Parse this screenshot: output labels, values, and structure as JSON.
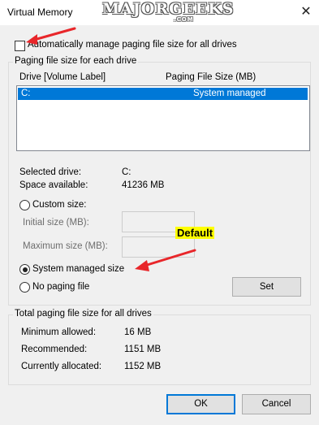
{
  "window": {
    "title": "Virtual Memory",
    "close_glyph": "✕"
  },
  "watermark": {
    "text": "MAJORGEEKS",
    "sub": ".COM"
  },
  "auto_manage": {
    "label": "Automatically manage paging file size for all drives",
    "checked": false
  },
  "paging_group": {
    "legend": "Paging file size for each drive",
    "columns": [
      "Drive  [Volume Label]",
      "Paging File Size (MB)"
    ],
    "rows": [
      {
        "drive": "C:",
        "size": "System managed"
      }
    ]
  },
  "drive_info": {
    "selected_label": "Selected drive:",
    "selected_value": "C:",
    "space_label": "Space available:",
    "space_value": "41236 MB"
  },
  "options": {
    "custom_size": "Custom size:",
    "initial_label": "Initial size (MB):",
    "maximum_label": "Maximum size (MB):",
    "system_managed": "System managed size",
    "no_paging": "No paging file",
    "selected": "system_managed",
    "set_button": "Set"
  },
  "callout": {
    "text": "Default"
  },
  "total_group": {
    "legend": "Total paging file size for all drives",
    "min_label": "Minimum allowed:",
    "min_value": "16 MB",
    "rec_label": "Recommended:",
    "rec_value": "1151 MB",
    "cur_label": "Currently allocated:",
    "cur_value": "1152 MB"
  },
  "footer": {
    "ok": "OK",
    "cancel": "Cancel"
  },
  "colors": {
    "selection": "#0078d7",
    "annotation_arrow": "#e8262a",
    "callout_bg": "#ffff00"
  }
}
